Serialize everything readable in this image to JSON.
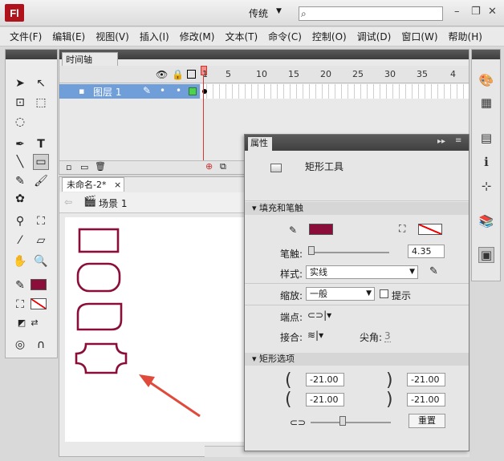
{
  "app": {
    "logo": "Fl",
    "workspace": "传统",
    "search_placeholder": ""
  },
  "menu": [
    "文件(F)",
    "编辑(E)",
    "视图(V)",
    "插入(I)",
    "修改(M)",
    "文本(T)",
    "命令(C)",
    "控制(O)",
    "调试(D)",
    "窗口(W)",
    "帮助(H)"
  ],
  "timeline": {
    "tab": "时间轴",
    "layer_name": "图层 1",
    "frame_numbers": [
      "1",
      "5",
      "10",
      "15",
      "20",
      "25",
      "30",
      "35",
      "4"
    ]
  },
  "document": {
    "tab": "未命名-2*",
    "close": "×",
    "scene": "场景 1"
  },
  "properties": {
    "tab": "属性",
    "tool_name": "矩形工具",
    "section_fill": "填充和笔触",
    "stroke_label": "笔触:",
    "stroke_value": "4.35",
    "style_label": "样式:",
    "style_value": "实线",
    "scale_label": "缩放:",
    "scale_value": "一般",
    "hint_label": "提示",
    "cap_label": "端点:",
    "join_label": "接合:",
    "miter_label": "尖角:",
    "miter_value": "3",
    "section_rect": "矩形选项",
    "radius_tl": "-21.00",
    "radius_tr": "-21.00",
    "radius_bl": "-21.00",
    "radius_br": "-21.00",
    "reset_label": "重置"
  },
  "colors": {
    "stroke": "#8b0d3a",
    "accent_layer": "#6f9ed9",
    "arrow": "#e04a3a"
  }
}
